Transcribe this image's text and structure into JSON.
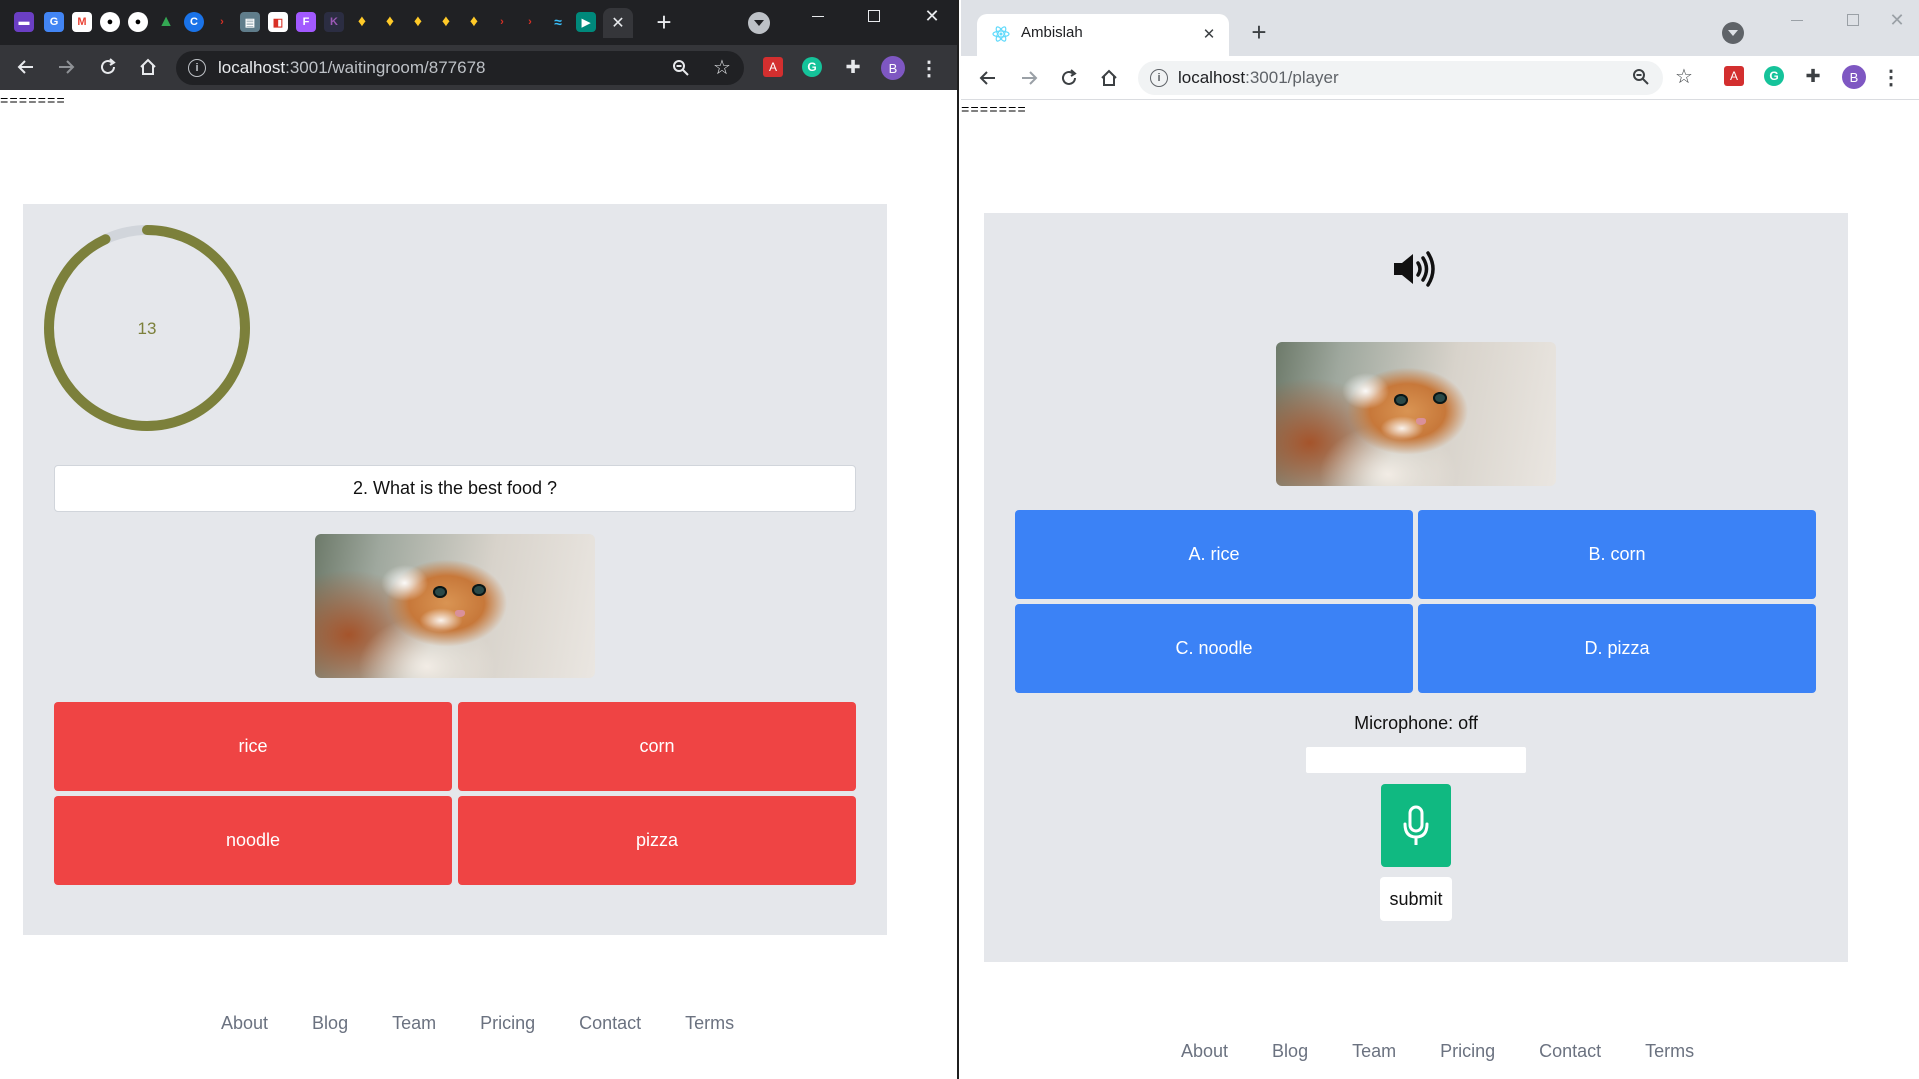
{
  "left_window": {
    "url_host": "localhost",
    "url_rest": ":3001/waitingroom/877678",
    "profile_initial": "B",
    "separator": "=======",
    "timer": {
      "value": "13",
      "progress_fraction": 0.93,
      "color": "#7c803b",
      "track_color": "#d1d5db"
    },
    "question": "2. What is the best food ?",
    "answers": [
      "rice",
      "corn",
      "noodle",
      "pizza"
    ],
    "footer_links": [
      "About",
      "Blog",
      "Team",
      "Pricing",
      "Contact",
      "Terms"
    ]
  },
  "right_window": {
    "tab_title": "Ambislah",
    "url_host": "localhost",
    "url_rest": ":3001/player",
    "profile_initial": "B",
    "separator": "=======",
    "answers": [
      "A. rice",
      "B. corn",
      "C. noodle",
      "D. pizza"
    ],
    "microphone_status": "Microphone: off",
    "transcript_value": "",
    "submit_label": "submit",
    "footer_links": [
      "About",
      "Blog",
      "Team",
      "Pricing",
      "Contact",
      "Terms"
    ]
  },
  "colors": {
    "answer_red": "#ef4444",
    "answer_blue": "#3b82f6",
    "mic_green": "#10b981",
    "panel_gray": "#e5e7eb"
  },
  "icons": {
    "left_tabstrip": [
      "gmail-icon",
      "docs-icon",
      "gmail-icon",
      "github-icon",
      "github-icon",
      "drive-icon",
      "c-icon",
      "arrow-icon",
      "calculator-icon",
      "figma-icon",
      "figma-icon",
      "firebase-icon",
      "firebase-icon",
      "firebase-icon",
      "firebase-icon",
      "firebase-icon",
      "arrow-icon",
      "arrow-icon",
      "tailwind-icon",
      "meet-icon"
    ],
    "sound": "speaker-icon",
    "microphone": "microphone-icon"
  }
}
